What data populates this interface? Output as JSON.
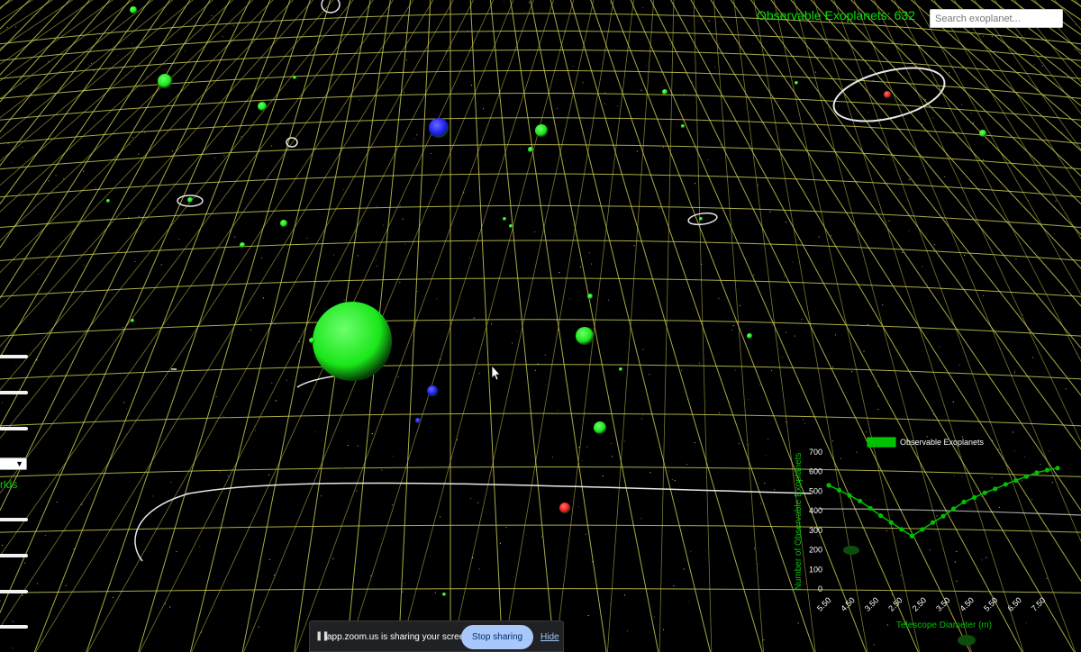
{
  "header": {
    "observable_label": "Observable Exoplanets: 632"
  },
  "search": {
    "placeholder": "Search exoplanet..."
  },
  "left_panel": {
    "partial_label": "rlds"
  },
  "share_bar": {
    "message": "app.zoom.us is sharing your screen.",
    "stop_label": "Stop sharing",
    "hide_label": "Hide"
  },
  "colors": {
    "grid": "#c8c850",
    "planet_green": "#19e619",
    "planet_blue": "#1a1aee",
    "planet_red": "#ee1a1a",
    "chart_green": "#00c000"
  },
  "chart_data": {
    "type": "line",
    "legend": [
      "Observable Exoplanets"
    ],
    "legend_position": "top",
    "xlabel": "Telescope Diameter (m)",
    "ylabel": "Number of Observable Exoplanets",
    "x_tick_labels": [
      "5.50",
      "4.50",
      "3.50",
      "2.50",
      "2.50",
      "3.50",
      "4.50",
      "5.50",
      "6.50",
      "7.50"
    ],
    "ylim": [
      0,
      700
    ],
    "y_ticks": [
      0,
      100,
      200,
      300,
      400,
      500,
      600,
      700
    ],
    "series": [
      {
        "name": "Observable Exoplanets",
        "values": [
          530,
          505,
          478,
          450,
          412,
          375,
          340,
          305,
          270,
          305,
          340,
          372,
          410,
          445,
          468,
          492,
          512,
          535,
          555,
          575,
          595,
          608,
          618
        ]
      }
    ]
  }
}
